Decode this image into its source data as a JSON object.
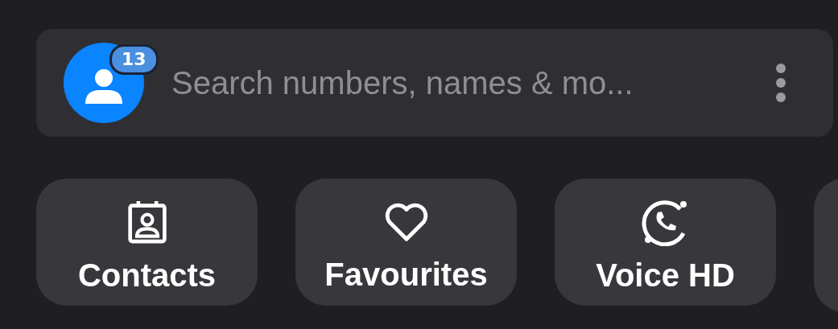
{
  "search": {
    "badge": "13",
    "placeholder": "Search numbers, names & mo..."
  },
  "chips": [
    {
      "kind": "contacts",
      "label": "Contacts"
    },
    {
      "kind": "favourites",
      "label": "Favourites"
    },
    {
      "kind": "voice",
      "label": "Voice HD"
    },
    {
      "kind": "cut"
    }
  ]
}
